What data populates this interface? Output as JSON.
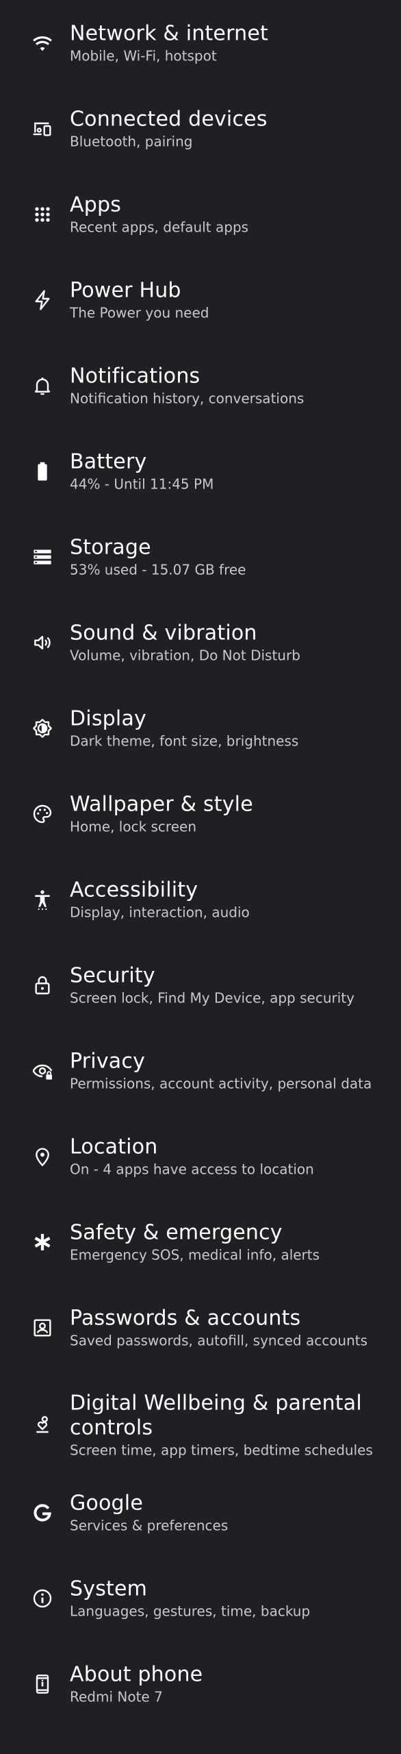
{
  "settings": {
    "items": [
      {
        "id": "network",
        "title": "Network & internet",
        "subtitle": "Mobile, Wi-Fi, hotspot",
        "icon": "wifi-icon"
      },
      {
        "id": "connected-devices",
        "title": "Connected devices",
        "subtitle": "Bluetooth, pairing",
        "icon": "devices-icon"
      },
      {
        "id": "apps",
        "title": "Apps",
        "subtitle": "Recent apps, default apps",
        "icon": "apps-grid-icon"
      },
      {
        "id": "power-hub",
        "title": "Power Hub",
        "subtitle": "The Power you need",
        "icon": "lightning-icon"
      },
      {
        "id": "notifications",
        "title": "Notifications",
        "subtitle": "Notification history, conversations",
        "icon": "bell-icon"
      },
      {
        "id": "battery",
        "title": "Battery",
        "subtitle": "44% - Until 11:45 PM",
        "icon": "battery-icon"
      },
      {
        "id": "storage",
        "title": "Storage",
        "subtitle": "53% used - 15.07 GB free",
        "icon": "storage-icon"
      },
      {
        "id": "sound",
        "title": "Sound & vibration",
        "subtitle": "Volume, vibration, Do Not Disturb",
        "icon": "speaker-icon"
      },
      {
        "id": "display",
        "title": "Display",
        "subtitle": "Dark theme, font size, brightness",
        "icon": "brightness-icon"
      },
      {
        "id": "wallpaper",
        "title": "Wallpaper & style",
        "subtitle": "Home, lock screen",
        "icon": "palette-icon"
      },
      {
        "id": "accessibility",
        "title": "Accessibility",
        "subtitle": "Display, interaction, audio",
        "icon": "accessibility-icon"
      },
      {
        "id": "security",
        "title": "Security",
        "subtitle": "Screen lock, Find My Device, app security",
        "icon": "lock-icon"
      },
      {
        "id": "privacy",
        "title": "Privacy",
        "subtitle": "Permissions, account activity, personal data",
        "icon": "eye-lock-icon"
      },
      {
        "id": "location",
        "title": "Location",
        "subtitle": "On - 4 apps have access to location",
        "icon": "location-pin-icon"
      },
      {
        "id": "safety",
        "title": "Safety & emergency",
        "subtitle": "Emergency SOS, medical info, alerts",
        "icon": "asterisk-icon"
      },
      {
        "id": "passwords",
        "title": "Passwords & accounts",
        "subtitle": "Saved passwords, autofill, synced accounts",
        "icon": "account-box-icon"
      },
      {
        "id": "wellbeing",
        "title": "Digital Wellbeing & parental controls",
        "subtitle": "Screen time, app timers, bedtime schedules",
        "icon": "wellbeing-icon"
      },
      {
        "id": "google",
        "title": "Google",
        "subtitle": "Services & preferences",
        "icon": "google-g-icon"
      },
      {
        "id": "system",
        "title": "System",
        "subtitle": "Languages, gestures, time, backup",
        "icon": "info-icon"
      },
      {
        "id": "about",
        "title": "About phone",
        "subtitle": "Redmi Note 7",
        "icon": "phone-icon"
      }
    ]
  },
  "colors": {
    "background": "#1f1f24",
    "title": "#ffffff",
    "subtitle": "#c9c7cf",
    "icon": "#ffffff"
  }
}
